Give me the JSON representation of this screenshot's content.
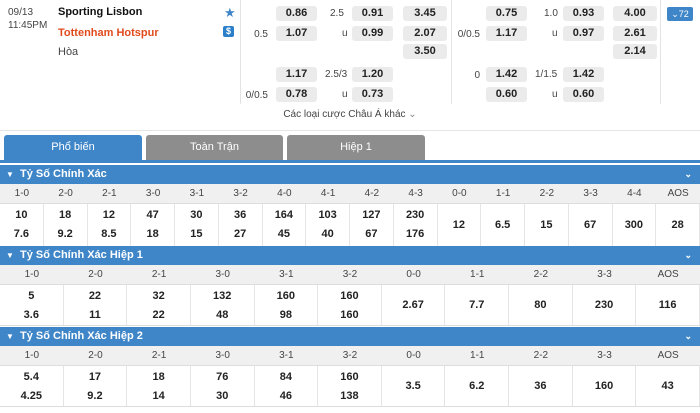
{
  "match": {
    "date": "09/13",
    "time": "11:45PM",
    "home": "Sporting Lisbon",
    "away": "Tottenham Hotspur",
    "draw": "Hòa",
    "more_count": "72",
    "more_link": "Các loại cược Châu Á khác"
  },
  "odds": {
    "ft": {
      "row1": {
        "hcap": "",
        "home": "0.86",
        "ou_line": "2.5",
        "over": "0.91",
        "x12": "3.45"
      },
      "row2": {
        "hcap": "0.5",
        "home": "1.07",
        "ou_line": "u",
        "over": "0.99",
        "x12": "2.07"
      },
      "row3": {
        "x12": "3.50"
      },
      "row4": {
        "hcap": "",
        "home": "1.17",
        "ou_line": "2.5/3",
        "over": "1.20"
      },
      "row5": {
        "hcap": "0/0.5",
        "home": "0.78",
        "ou_line": "u",
        "over": "0.73"
      }
    },
    "h1": {
      "row1": {
        "hcap": "",
        "home": "0.75",
        "ou_line": "1.0",
        "over": "0.93",
        "x12": "4.00"
      },
      "row2": {
        "hcap": "0/0.5",
        "home": "1.17",
        "ou_line": "u",
        "over": "0.97",
        "x12": "2.61"
      },
      "row3": {
        "x12": "2.14"
      },
      "row4": {
        "hcap": "0",
        "home": "1.42",
        "ou_line": "1/1.5",
        "over": "1.42"
      },
      "row5": {
        "hcap": "",
        "home": "0.60",
        "ou_line": "u",
        "over": "0.60"
      }
    }
  },
  "tabs": [
    {
      "label": "Phổ biến"
    },
    {
      "label": "Toàn Trận"
    },
    {
      "label": "Hiệp 1"
    }
  ],
  "sections": [
    {
      "title": "Tỷ Số Chính Xác",
      "labels": [
        "1-0",
        "2-0",
        "2-1",
        "3-0",
        "3-1",
        "3-2",
        "4-0",
        "4-1",
        "4-2",
        "4-3",
        "0-0",
        "1-1",
        "2-2",
        "3-3",
        "4-4",
        "AOS"
      ],
      "top": [
        "10",
        "18",
        "12",
        "47",
        "30",
        "36",
        "164",
        "103",
        "127",
        "230",
        "12",
        "6.5",
        "15",
        "67",
        "300",
        "28"
      ],
      "bottom": [
        "7.6",
        "9.2",
        "8.5",
        "18",
        "15",
        "27",
        "45",
        "40",
        "67",
        "176",
        "",
        "",
        "",
        "",
        "",
        ""
      ]
    },
    {
      "title": "Tỷ Số Chính Xác Hiệp 1",
      "labels": [
        "1-0",
        "2-0",
        "2-1",
        "3-0",
        "3-1",
        "3-2",
        "0-0",
        "1-1",
        "2-2",
        "3-3",
        "AOS"
      ],
      "top": [
        "5",
        "22",
        "32",
        "132",
        "160",
        "160",
        "2.67",
        "7.7",
        "80",
        "230",
        "116"
      ],
      "bottom": [
        "3.6",
        "11",
        "22",
        "48",
        "98",
        "160",
        "",
        "",
        "",
        "",
        ""
      ]
    },
    {
      "title": "Tỷ Số Chính Xác Hiệp 2",
      "labels": [
        "1-0",
        "2-0",
        "2-1",
        "3-0",
        "3-1",
        "3-2",
        "0-0",
        "1-1",
        "2-2",
        "3-3",
        "AOS"
      ],
      "top": [
        "5.4",
        "17",
        "18",
        "76",
        "84",
        "160",
        "3.5",
        "6.2",
        "36",
        "160",
        "43"
      ],
      "bottom": [
        "4.25",
        "9.2",
        "14",
        "30",
        "46",
        "138",
        "",
        "",
        "",
        "",
        ""
      ]
    }
  ],
  "icons": {
    "favorite": "star-icon",
    "live": "dollar-icon",
    "collapse": "triangle-down-icon",
    "expand_more": "chevron-down-icon"
  },
  "colors": {
    "accent": "#3f86c8",
    "away_team": "#e04a1c",
    "inactive_tab": "#8d8d8d"
  }
}
